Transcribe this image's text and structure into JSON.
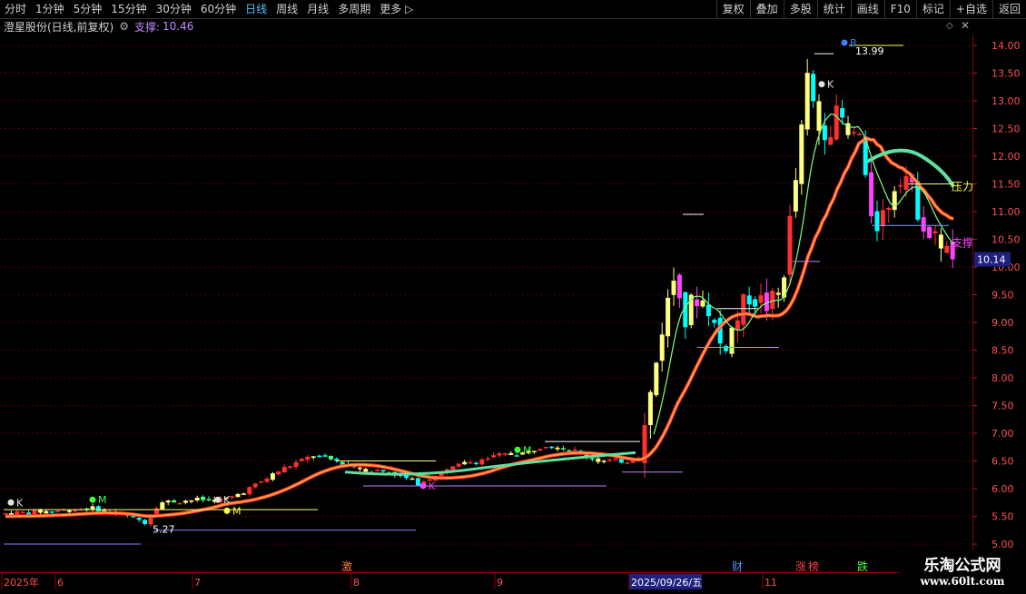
{
  "toolbar": {
    "tabs": [
      "分时",
      "1分钟",
      "5分钟",
      "15分钟",
      "30分钟",
      "60分钟",
      "日线",
      "周线",
      "月线",
      "多周期",
      "更多"
    ],
    "active_tab": "日线",
    "right_buttons": [
      "复权",
      "叠加",
      "多股",
      "统计",
      "画线",
      "F10",
      "标记",
      "+自选",
      "返回"
    ]
  },
  "header": {
    "title": "澄星股份(日线,前复权)",
    "support_label": "支撑:",
    "support_value": "10.46"
  },
  "price_axis": {
    "ticks": [
      "14.00",
      "13.50",
      "13.00",
      "12.50",
      "12.00",
      "11.50",
      "11.00",
      "10.50",
      "10.00",
      "9.50",
      "9.00",
      "8.50",
      "8.00",
      "7.50",
      "7.00",
      "6.50",
      "6.00",
      "5.50",
      "5.00"
    ],
    "current_price": "10.14"
  },
  "annotations": {
    "high_label": "13.99",
    "low_label": "5.27",
    "pressure_label": "压力",
    "support_label": "支撑",
    "k_label": "K",
    "m_label": "M",
    "b_label": "B"
  },
  "timeline": {
    "labels": [
      "2025年",
      "6",
      "7",
      "8",
      "9",
      "2025/09/26/五",
      "11"
    ],
    "markers": [
      "激",
      "财",
      "涨",
      "榜",
      "跌"
    ]
  },
  "watermark": {
    "line1": "乐淘公式网",
    "line2": "www.60lt.com"
  },
  "colors": {
    "up": "#ff3030",
    "down": "#00ffff",
    "yellow": "#ffff80",
    "magenta": "#ff40ff",
    "ma_long": "#ffa040",
    "ma_green": "#80ff80"
  }
}
